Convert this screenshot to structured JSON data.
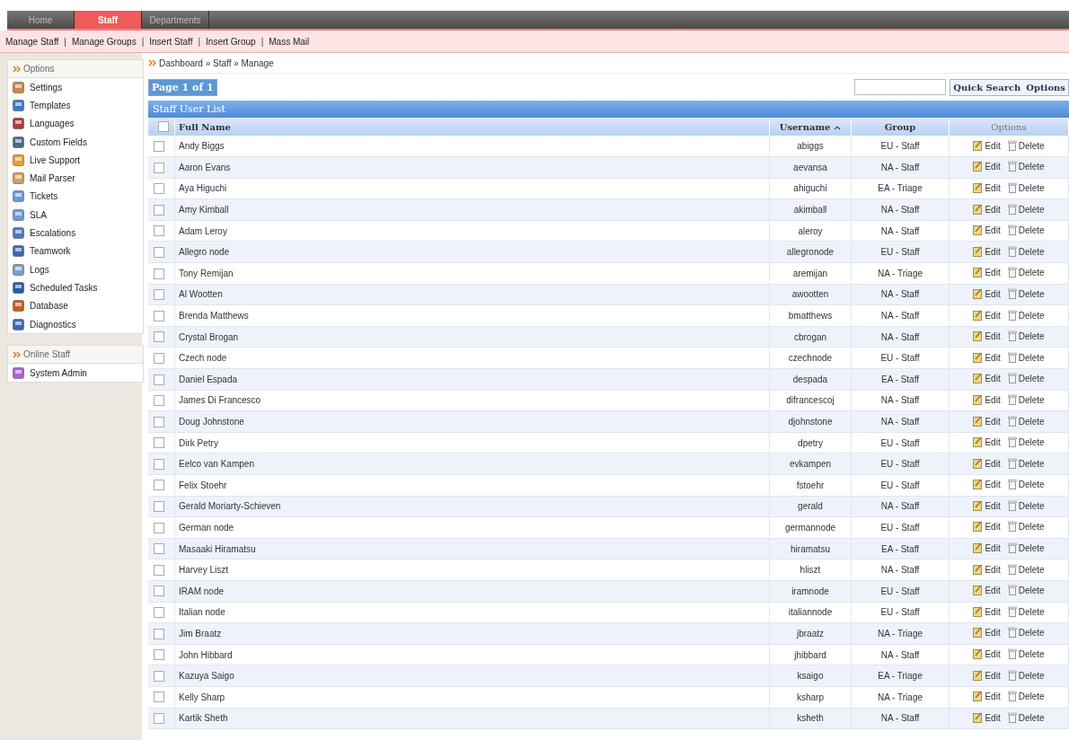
{
  "tabs": [
    {
      "label": "Home",
      "selected": false
    },
    {
      "label": "Staff",
      "selected": true
    },
    {
      "label": "Departments",
      "selected": false
    }
  ],
  "subnav": {
    "separator": "|",
    "items": [
      "Manage Staff",
      "Manage Groups",
      "Insert Staff",
      "Insert Group",
      "Mass Mail"
    ]
  },
  "sidebar": [
    {
      "title": "Options",
      "items": [
        "Settings",
        "Templates",
        "Languages",
        "Custom Fields",
        "Live Support",
        "Mail Parser",
        "Tickets",
        "SLA",
        "Escalations",
        "Teamwork",
        "Logs",
        "Scheduled Tasks",
        "Database",
        "Diagnostics"
      ]
    },
    {
      "title": "Online Staff",
      "items": [
        "System Admin"
      ]
    }
  ],
  "breadcrumb": "Dashboard » Staff » Manage",
  "pager": "Page 1 of 1",
  "search": {
    "button": "Quick Search",
    "options": "Options"
  },
  "table": {
    "title": "Staff User List",
    "select_all_checked": false,
    "columns": [
      {
        "label": "Full Name",
        "sorted": false
      },
      {
        "label": "Username",
        "sorted": true
      },
      {
        "label": "Group",
        "sorted": false
      },
      {
        "label": "Options",
        "sorted": false
      }
    ],
    "actions": [
      {
        "edit": "Edit",
        "delete": "Delete"
      },
      {
        "edit": "Edit",
        "delete": "Delete"
      },
      {
        "edit": "Edit",
        "delete": "Delete"
      },
      {
        "edit": "Edit",
        "delete": "Delete"
      },
      {
        "edit": "Edit",
        "delete": "Delete"
      },
      {
        "edit": "Edit",
        "delete": "Delete"
      },
      {
        "edit": "Edit",
        "delete": "Delete"
      },
      {
        "edit": "Edit",
        "delete": "Delete"
      },
      {
        "edit": "Edit",
        "delete": "Delete"
      },
      {
        "edit": "Edit",
        "delete": "Delete"
      },
      {
        "edit": "Edit",
        "delete": "Delete"
      },
      {
        "edit": "Edit",
        "delete": "Delete"
      },
      {
        "edit": "Edit",
        "delete": "Delete"
      },
      {
        "edit": "Edit",
        "delete": "Delete"
      },
      {
        "edit": "Edit",
        "delete": "Delete"
      },
      {
        "edit": "Edit",
        "delete": "Delete"
      },
      {
        "edit": "Edit",
        "delete": "Delete"
      },
      {
        "edit": "Edit",
        "delete": "Delete"
      },
      {
        "edit": "Edit",
        "delete": "Delete"
      },
      {
        "edit": "Edit",
        "delete": "Delete"
      },
      {
        "edit": "Edit",
        "delete": "Delete"
      },
      {
        "edit": "Edit",
        "delete": "Delete"
      },
      {
        "edit": "Edit",
        "delete": "Delete"
      },
      {
        "edit": "Edit",
        "delete": "Delete"
      },
      {
        "edit": "Edit",
        "delete": "Delete"
      },
      {
        "edit": "Edit",
        "delete": "Delete"
      },
      {
        "edit": "Edit",
        "delete": "Delete"
      },
      {
        "edit": "Edit",
        "delete": "Delete"
      }
    ],
    "rows": [
      {
        "name": "Andy Biggs",
        "username": "abiggs",
        "group": "EU - Staff",
        "checked": false
      },
      {
        "name": "Aaron Evans",
        "username": "aevansa",
        "group": "NA - Staff",
        "checked": false
      },
      {
        "name": "Aya Higuchi",
        "username": "ahiguchi",
        "group": "EA - Triage",
        "checked": false
      },
      {
        "name": "Amy Kimball",
        "username": "akimball",
        "group": "NA - Staff",
        "checked": false
      },
      {
        "name": "Adam Leroy",
        "username": "aleroy",
        "group": "NA - Staff",
        "checked": false
      },
      {
        "name": "Allegro node",
        "username": "allegronode",
        "group": "EU - Staff",
        "checked": false
      },
      {
        "name": "Tony Remijan",
        "username": "aremijan",
        "group": "NA - Triage",
        "checked": false
      },
      {
        "name": "Al Wootten",
        "username": "awootten",
        "group": "NA - Staff",
        "checked": false
      },
      {
        "name": "Brenda Matthews",
        "username": "bmatthews",
        "group": "NA - Staff",
        "checked": false
      },
      {
        "name": "Crystal Brogan",
        "username": "cbrogan",
        "group": "NA - Staff",
        "checked": false
      },
      {
        "name": "Czech node",
        "username": "czechnode",
        "group": "EU - Staff",
        "checked": false
      },
      {
        "name": "Daniel Espada",
        "username": "despada",
        "group": "EA - Staff",
        "checked": false
      },
      {
        "name": "James Di Francesco",
        "username": "difrancescoj",
        "group": "NA - Staff",
        "checked": false
      },
      {
        "name": "Doug Johnstone",
        "username": "djohnstone",
        "group": "NA - Staff",
        "checked": false
      },
      {
        "name": "Dirk Petry",
        "username": "dpetry",
        "group": "EU - Staff",
        "checked": false
      },
      {
        "name": "Eelco van Kampen",
        "username": "evkampen",
        "group": "EU - Staff",
        "checked": false
      },
      {
        "name": "Felix Stoehr",
        "username": "fstoehr",
        "group": "EU - Staff",
        "checked": false
      },
      {
        "name": "Gerald Moriarty-Schieven",
        "username": "gerald",
        "group": "NA - Staff",
        "checked": false
      },
      {
        "name": "German node",
        "username": "germannode",
        "group": "EU - Staff",
        "checked": false
      },
      {
        "name": "Masaaki Hiramatsu",
        "username": "hiramatsu",
        "group": "EA - Staff",
        "checked": false
      },
      {
        "name": "Harvey Liszt",
        "username": "hliszt",
        "group": "NA - Staff",
        "checked": false
      },
      {
        "name": "IRAM node",
        "username": "iramnode",
        "group": "EU - Staff",
        "checked": false
      },
      {
        "name": "Italian node",
        "username": "italiannode",
        "group": "EU - Staff",
        "checked": false
      },
      {
        "name": "Jim Braatz",
        "username": "jbraatz",
        "group": "NA - Triage",
        "checked": false
      },
      {
        "name": "John Hibbard",
        "username": "jhibbard",
        "group": "NA - Staff",
        "checked": false
      },
      {
        "name": "Kazuya Saigo",
        "username": "ksaigo",
        "group": "EA - Triage",
        "checked": false
      },
      {
        "name": "Kelly Sharp",
        "username": "ksharp",
        "group": "NA - Triage",
        "checked": false
      },
      {
        "name": "Kartik Sheth",
        "username": "ksheth",
        "group": "NA - Staff",
        "checked": false
      }
    ]
  }
}
